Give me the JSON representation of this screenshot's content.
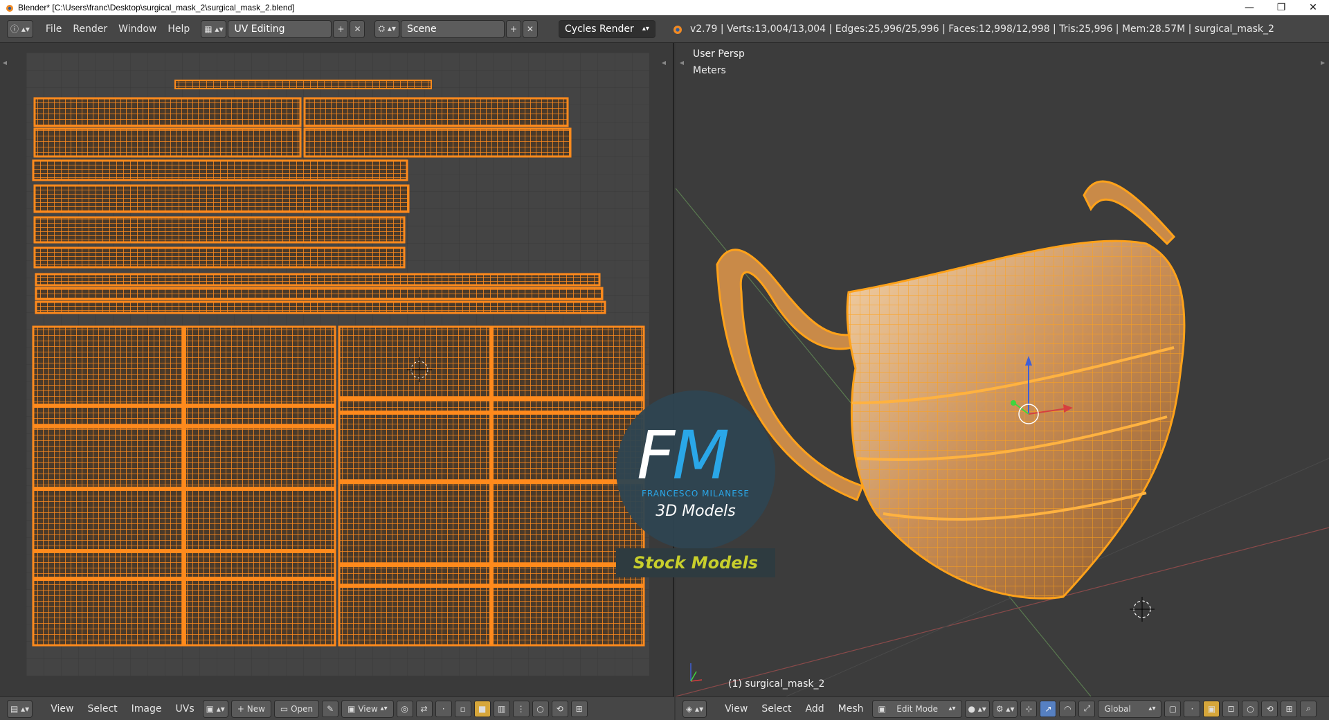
{
  "window": {
    "title": "Blender* [C:\\Users\\franc\\Desktop\\surgical_mask_2\\surgical_mask_2.blend]",
    "minimize": "—",
    "restore": "❐",
    "close": "✕"
  },
  "header": {
    "menus": [
      "File",
      "Render",
      "Window",
      "Help"
    ],
    "screen_layout": "UV Editing",
    "scene": "Scene",
    "render_engine": "Cycles Render",
    "stats": "v2.79 | Verts:13,004/13,004 | Edges:25,996/25,996 | Faces:12,998/12,998 | Tris:25,996 | Mem:28.57M | surgical_mask_2"
  },
  "viewport": {
    "view_name": "User Persp",
    "units": "Meters",
    "object_label": "(1) surgical_mask_2"
  },
  "uv_bottom": {
    "menus": [
      "View",
      "Select",
      "Image",
      "UVs"
    ],
    "new_label": "New",
    "open_label": "Open",
    "view_label": "View"
  },
  "vp_bottom": {
    "menus": [
      "View",
      "Select",
      "Add",
      "Mesh"
    ],
    "mode": "Edit Mode",
    "orientation": "Global"
  },
  "watermark": {
    "fm_f": "F",
    "fm_m": "M",
    "name": "FRANCESCO MILANESE",
    "sub": "3D Models",
    "stock": "Stock Models"
  },
  "colors": {
    "uv_orange": "#ff8a1c",
    "mesh_orange": "#f5a623",
    "accent_blue": "#2aa7e8",
    "stock_yellow": "#c8cf2c"
  }
}
